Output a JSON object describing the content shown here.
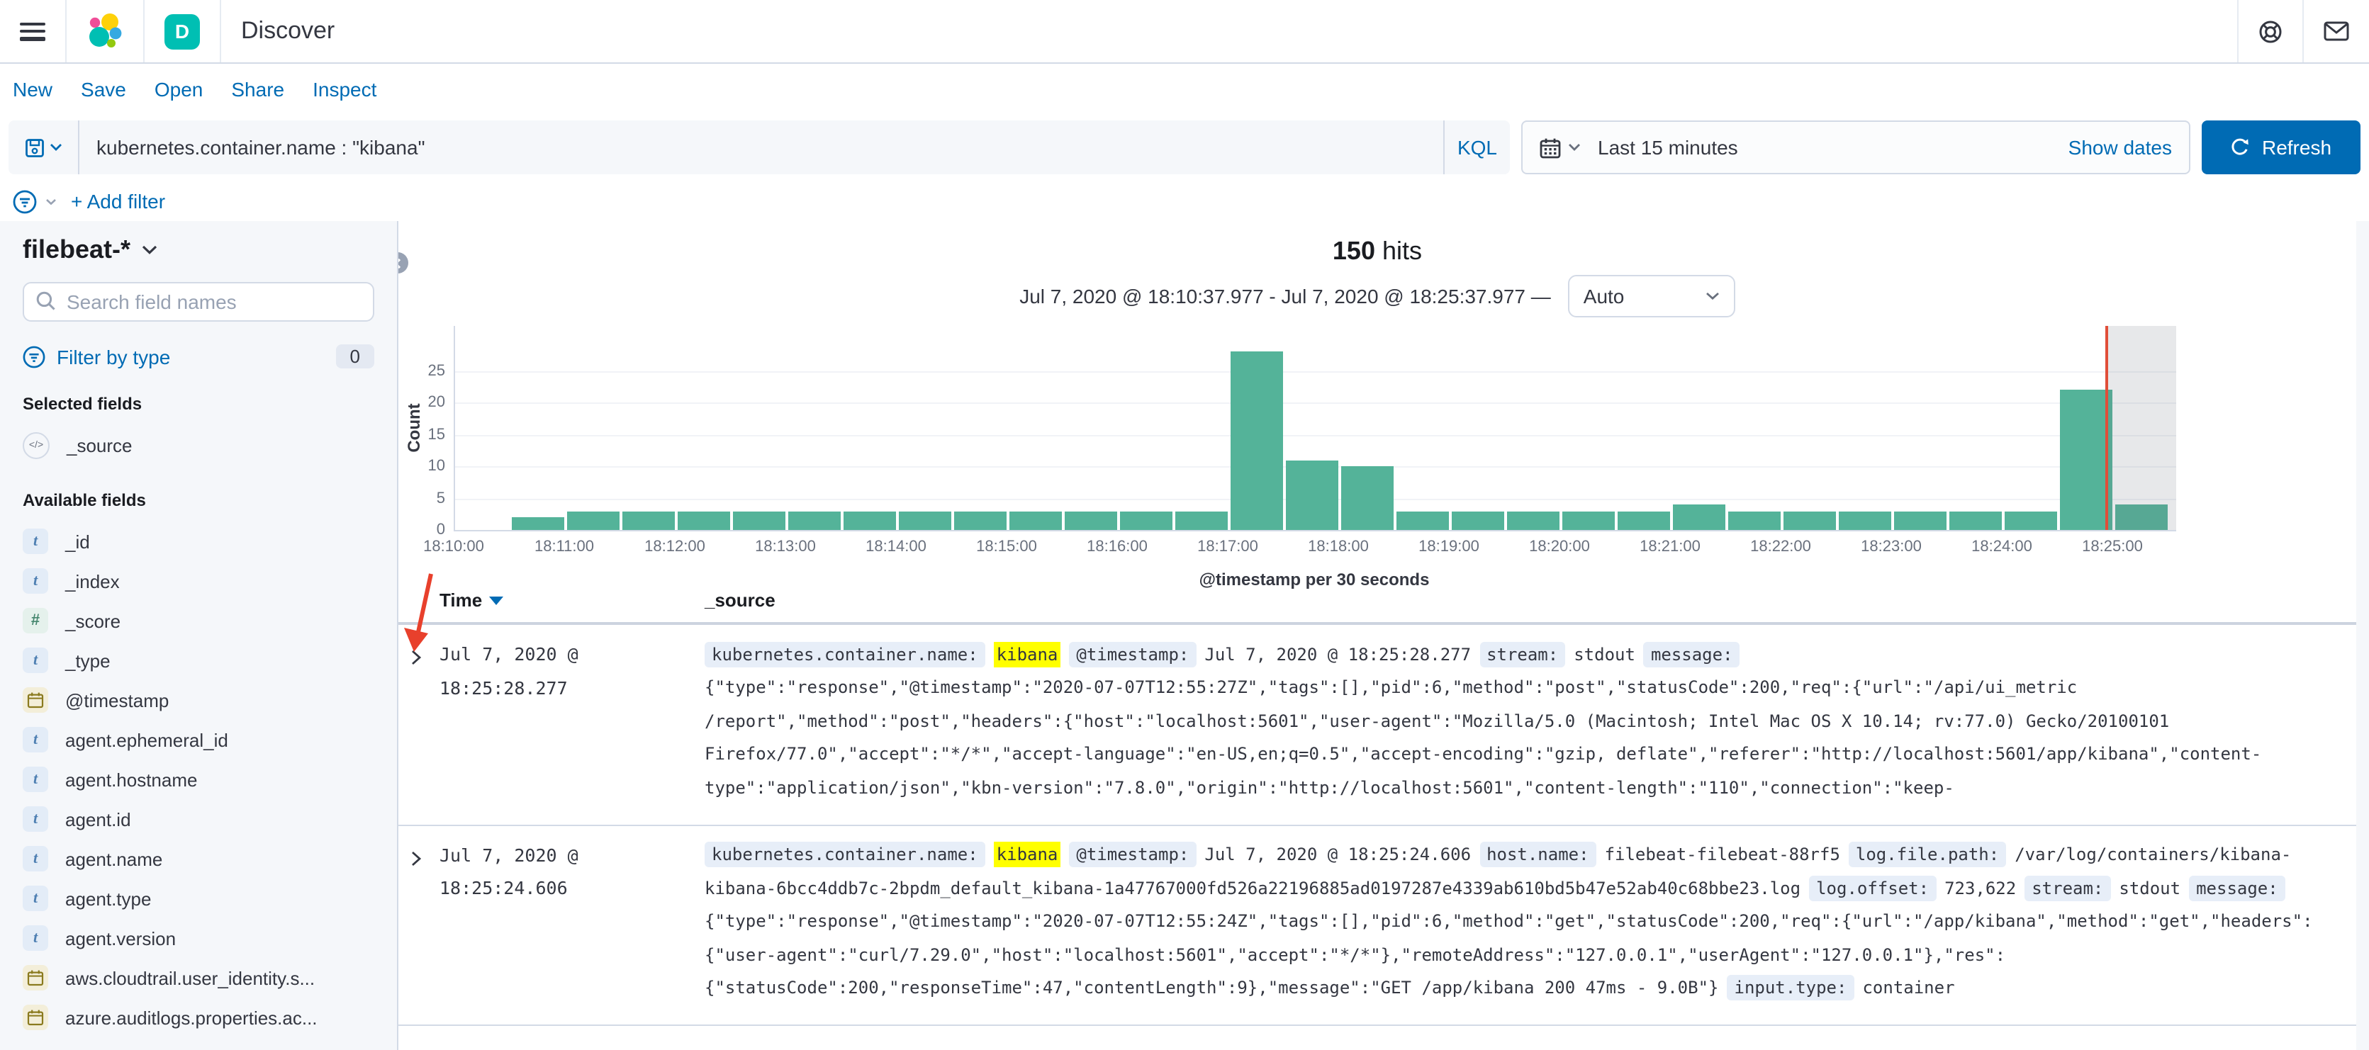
{
  "header": {
    "title": "Discover",
    "space_initial": "D"
  },
  "nav": {
    "items": [
      "New",
      "Save",
      "Open",
      "Share",
      "Inspect"
    ]
  },
  "query_bar": {
    "query": "kubernetes.container.name : \"kibana\"",
    "language": "KQL",
    "time_range": "Last 15 minutes",
    "show_dates_label": "Show dates",
    "refresh_label": "Refresh"
  },
  "filter_bar": {
    "add_filter_label": "+ Add filter"
  },
  "sidebar": {
    "index_pattern": "filebeat-*",
    "search_placeholder": "Search field names",
    "filter_by_type_label": "Filter by type",
    "filter_count": "0",
    "selected_heading": "Selected fields",
    "selected_fields": [
      {
        "name": "_source",
        "type": "source"
      }
    ],
    "available_heading": "Available fields",
    "available_fields": [
      {
        "name": "_id",
        "type": "string"
      },
      {
        "name": "_index",
        "type": "string"
      },
      {
        "name": "_score",
        "type": "number"
      },
      {
        "name": "_type",
        "type": "string"
      },
      {
        "name": "@timestamp",
        "type": "date"
      },
      {
        "name": "agent.ephemeral_id",
        "type": "string"
      },
      {
        "name": "agent.hostname",
        "type": "string"
      },
      {
        "name": "agent.id",
        "type": "string"
      },
      {
        "name": "agent.name",
        "type": "string"
      },
      {
        "name": "agent.type",
        "type": "string"
      },
      {
        "name": "agent.version",
        "type": "string"
      },
      {
        "name": "aws.cloudtrail.user_identity.s...",
        "type": "date"
      },
      {
        "name": "azure.auditlogs.properties.ac...",
        "type": "date"
      }
    ]
  },
  "results": {
    "hits_count": "150",
    "hits_label": "hits",
    "time_range_display": "Jul 7, 2020 @ 18:10:37.977 - Jul 7, 2020 @ 18:25:37.977 —",
    "interval_value": "Auto"
  },
  "chart_data": {
    "type": "bar",
    "title": "",
    "xlabel": "@timestamp per 30 seconds",
    "ylabel": "Count",
    "ylim": [
      0,
      30
    ],
    "yticks": [
      0,
      5,
      10,
      15,
      20,
      25
    ],
    "bar_color": "#54b399",
    "bucket_seconds": 30,
    "x_tick_labels": [
      "18:10:00",
      "18:11:00",
      "18:12:00",
      "18:13:00",
      "18:14:00",
      "18:15:00",
      "18:16:00",
      "18:17:00",
      "18:18:00",
      "18:19:00",
      "18:20:00",
      "18:21:00",
      "18:22:00",
      "18:23:00",
      "18:24:00",
      "18:25:00"
    ],
    "buckets": [
      {
        "time": "18:10:30",
        "count": 2
      },
      {
        "time": "18:11:00",
        "count": 3
      },
      {
        "time": "18:11:30",
        "count": 3
      },
      {
        "time": "18:12:00",
        "count": 3
      },
      {
        "time": "18:12:30",
        "count": 3
      },
      {
        "time": "18:13:00",
        "count": 3
      },
      {
        "time": "18:13:30",
        "count": 3
      },
      {
        "time": "18:14:00",
        "count": 3
      },
      {
        "time": "18:14:30",
        "count": 3
      },
      {
        "time": "18:15:00",
        "count": 3
      },
      {
        "time": "18:15:30",
        "count": 3
      },
      {
        "time": "18:16:00",
        "count": 3
      },
      {
        "time": "18:16:30",
        "count": 3
      },
      {
        "time": "18:17:00",
        "count": 28
      },
      {
        "time": "18:17:30",
        "count": 11
      },
      {
        "time": "18:18:00",
        "count": 10
      },
      {
        "time": "18:18:30",
        "count": 3
      },
      {
        "time": "18:19:00",
        "count": 3
      },
      {
        "time": "18:19:30",
        "count": 3
      },
      {
        "time": "18:20:00",
        "count": 3
      },
      {
        "time": "18:20:30",
        "count": 3
      },
      {
        "time": "18:21:00",
        "count": 4
      },
      {
        "time": "18:21:30",
        "count": 3
      },
      {
        "time": "18:22:00",
        "count": 3
      },
      {
        "time": "18:22:30",
        "count": 3
      },
      {
        "time": "18:23:00",
        "count": 3
      },
      {
        "time": "18:23:30",
        "count": 3
      },
      {
        "time": "18:24:00",
        "count": 3
      },
      {
        "time": "18:24:30",
        "count": 22
      },
      {
        "time": "18:25:00",
        "count": 4
      }
    ],
    "current_time_marker": "18:24:55",
    "partial_bucket_region": {
      "from": "18:24:55",
      "to": "18:25:33"
    }
  },
  "table": {
    "columns": [
      "Time",
      "_source"
    ],
    "rows": [
      {
        "time": "Jul 7, 2020 @ 18:25:28.277",
        "lines": [
          [
            {
              "t": "field",
              "v": "kubernetes.container.name:"
            },
            {
              "t": "hl",
              "v": "kibana"
            },
            {
              "t": "field",
              "v": "@timestamp:"
            },
            {
              "t": "text",
              "v": "Jul 7, 2020 @ 18:25:28.277"
            },
            {
              "t": "field",
              "v": "stream:"
            },
            {
              "t": "text",
              "v": "stdout"
            },
            {
              "t": "field",
              "v": "message:"
            }
          ],
          [
            {
              "t": "text",
              "v": "{\"type\":\"response\",\"@timestamp\":\"2020-07-07T12:55:27Z\",\"tags\":[],\"pid\":6,\"method\":\"post\",\"statusCode\":200,\"req\":{\"url\":\"/api/ui_metric"
            }
          ],
          [
            {
              "t": "text",
              "v": "/report\",\"method\":\"post\",\"headers\":{\"host\":\"localhost:5601\",\"user-agent\":\"Mozilla/5.0 (Macintosh; Intel Mac OS X 10.14; rv:77.0) Gecko/20100101"
            }
          ],
          [
            {
              "t": "text",
              "v": "Firefox/77.0\",\"accept\":\"*/*\",\"accept-language\":\"en-US,en;q=0.5\",\"accept-encoding\":\"gzip, deflate\",\"referer\":\"http://localhost:5601/app/kibana\",\"content-"
            }
          ],
          [
            {
              "t": "text",
              "v": "type\":\"application/json\",\"kbn-version\":\"7.8.0\",\"origin\":\"http://localhost:5601\",\"content-length\":\"110\",\"connection\":\"keep-"
            }
          ]
        ]
      },
      {
        "time": "Jul 7, 2020 @ 18:25:24.606",
        "lines": [
          [
            {
              "t": "field",
              "v": "kubernetes.container.name:"
            },
            {
              "t": "hl",
              "v": "kibana"
            },
            {
              "t": "field",
              "v": "@timestamp:"
            },
            {
              "t": "text",
              "v": "Jul 7, 2020 @ 18:25:24.606"
            },
            {
              "t": "field",
              "v": "host.name:"
            },
            {
              "t": "text",
              "v": "filebeat-filebeat-88rf5"
            },
            {
              "t": "field",
              "v": "log.file.path:"
            },
            {
              "t": "text",
              "v": "/var/log/containers/kibana-"
            }
          ],
          [
            {
              "t": "text",
              "v": "kibana-6bcc4ddb7c-2bpdm_default_kibana-1a47767000fd526a22196885ad0197287e4339ab610bd5b47e52ab40c68bbe23.log"
            },
            {
              "t": "field",
              "v": "log.offset:"
            },
            {
              "t": "text",
              "v": "723,622"
            },
            {
              "t": "field",
              "v": "stream:"
            },
            {
              "t": "text",
              "v": "stdout"
            },
            {
              "t": "field",
              "v": "message:"
            }
          ],
          [
            {
              "t": "text",
              "v": "{\"type\":\"response\",\"@timestamp\":\"2020-07-07T12:55:24Z\",\"tags\":[],\"pid\":6,\"method\":\"get\",\"statusCode\":200,\"req\":{\"url\":\"/app/kibana\",\"method\":\"get\",\"headers\":"
            }
          ],
          [
            {
              "t": "text",
              "v": "{\"user-agent\":\"curl/7.29.0\",\"host\":\"localhost:5601\",\"accept\":\"*/*\"},\"remoteAddress\":\"127.0.0.1\",\"userAgent\":\"127.0.0.1\"},\"res\":"
            }
          ],
          [
            {
              "t": "text",
              "v": "{\"statusCode\":200,\"responseTime\":47,\"contentLength\":9},\"message\":\"GET /app/kibana 200 47ms - 9.0B\"}"
            },
            {
              "t": "field",
              "v": "input.type:"
            },
            {
              "t": "text",
              "v": "container"
            }
          ]
        ]
      }
    ]
  }
}
